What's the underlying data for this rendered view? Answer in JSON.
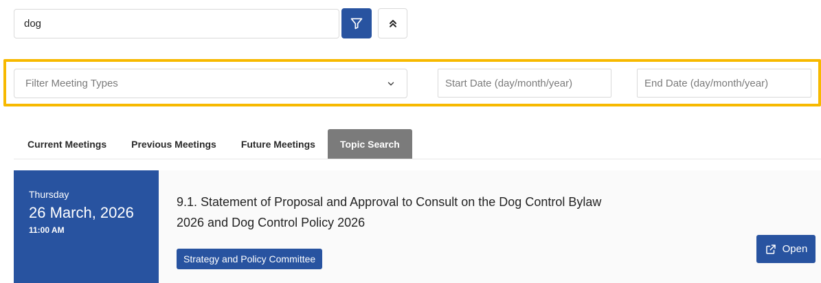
{
  "search": {
    "value": "dog",
    "filter_icon": "filter-icon",
    "collapse_icon": "chevrons-up-icon"
  },
  "filters": {
    "meeting_type_placeholder": "Filter Meeting Types",
    "meeting_type_icon": "chevron-down-icon",
    "start_date_placeholder": "Start Date (day/month/year)",
    "end_date_placeholder": "End Date (day/month/year)"
  },
  "tabs": [
    {
      "label": "Current Meetings",
      "active": false
    },
    {
      "label": "Previous Meetings",
      "active": false
    },
    {
      "label": "Future Meetings",
      "active": false
    },
    {
      "label": "Topic Search",
      "active": true
    }
  ],
  "result": {
    "weekday": "Thursday",
    "date": "26 March, 2026",
    "time": "11:00 AM",
    "title_line1": "9.1. Statement of Proposal and Approval to Consult on the Dog Control Bylaw",
    "title_line2": "2026 and Dog Control Policy 2026",
    "committee": "Strategy and Policy Committee",
    "open_label": "Open",
    "open_icon": "external-link-icon"
  },
  "colors": {
    "primary": "#2853a0",
    "highlight": "#f7b900",
    "active_tab": "#7b7b7b"
  }
}
